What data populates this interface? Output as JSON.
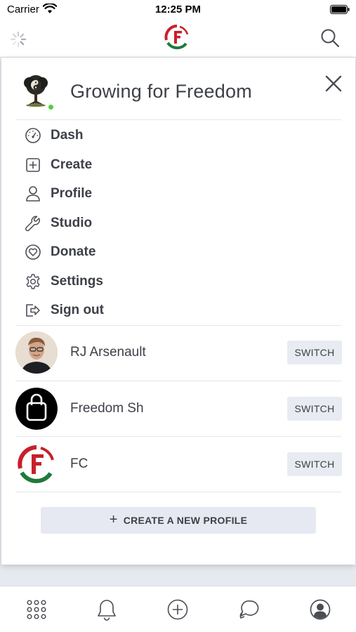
{
  "status_bar": {
    "carrier": "Carrier",
    "time": "12:25 PM"
  },
  "top_nav": {
    "left_icon": "loading-spinner-icon",
    "center_icon": "app-logo-icon",
    "right_icon": "search-icon"
  },
  "panel": {
    "title": "Growing for Freedom",
    "online_status_color": "#4cd137",
    "menu": [
      {
        "label": "Dash",
        "icon": "dashboard-gauge-icon"
      },
      {
        "label": "Create",
        "icon": "plus-square-icon"
      },
      {
        "label": "Profile",
        "icon": "user-icon"
      },
      {
        "label": "Studio",
        "icon": "wrench-icon"
      },
      {
        "label": "Donate",
        "icon": "heart-circle-icon"
      },
      {
        "label": "Settings",
        "icon": "gear-icon"
      },
      {
        "label": "Sign out",
        "icon": "sign-out-icon"
      }
    ],
    "accounts": [
      {
        "name": "RJ Arsenault",
        "switch_label": "SWITCH",
        "avatar": "person-photo"
      },
      {
        "name": "Freedom Sh",
        "switch_label": "SWITCH",
        "avatar": "shopping-bag-icon"
      },
      {
        "name": "FC",
        "switch_label": "SWITCH",
        "avatar": "app-logo-icon"
      }
    ],
    "create_profile_label": "CREATE A NEW PROFILE"
  },
  "tab_bar": {
    "tabs": [
      {
        "icon": "apps-grid-icon"
      },
      {
        "icon": "bell-icon"
      },
      {
        "icon": "plus-circle-icon"
      },
      {
        "icon": "chat-bubbles-icon"
      },
      {
        "icon": "account-circle-icon"
      }
    ]
  },
  "colors": {
    "logo_red": "#c8202b",
    "logo_green": "#1f7a3a",
    "text": "#3d4047",
    "button_bg": "#e8ebf2"
  }
}
